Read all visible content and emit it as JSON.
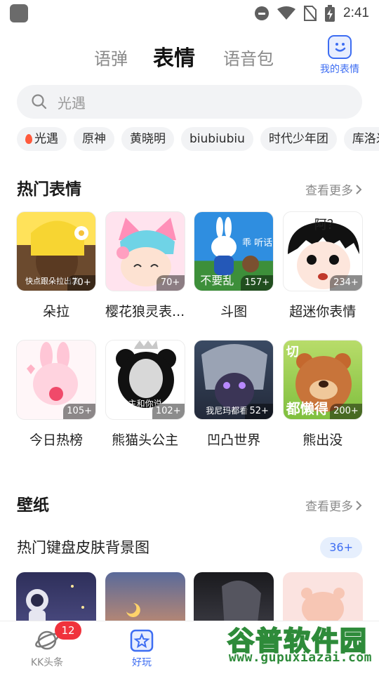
{
  "status_bar": {
    "time": "2:41"
  },
  "tabs": [
    {
      "label": "语弹"
    },
    {
      "label": "表情"
    },
    {
      "label": "语音包"
    }
  ],
  "my_emoji": {
    "label": "我的表情"
  },
  "search": {
    "placeholder": "光遇"
  },
  "chips": [
    {
      "label": "光遇"
    },
    {
      "label": "原神"
    },
    {
      "label": "黄晓明"
    },
    {
      "label": "biubiubiu"
    },
    {
      "label": "时代少年团"
    },
    {
      "label": "库洛米"
    }
  ],
  "hot_emoji": {
    "title": "热门表情",
    "more": "查看更多",
    "items": [
      {
        "label": "朵拉",
        "count": "70+",
        "caption": "快点跟朵拉出发"
      },
      {
        "label": "樱花狼灵表...",
        "count": "70+",
        "caption": ""
      },
      {
        "label": "斗图",
        "count": "157+",
        "caption": "不要乱"
      },
      {
        "label": "超迷你表情",
        "count": "234+",
        "caption": "阿？"
      },
      {
        "label": "今日热榜",
        "count": "105+",
        "caption": ""
      },
      {
        "label": "熊猫头公主",
        "count": "102+",
        "caption": "本公主和你说"
      },
      {
        "label": "凹凸世界",
        "count": "52+",
        "caption": "我尼玛都看"
      },
      {
        "label": "熊出没",
        "count": "200+",
        "caption": "都懒得"
      }
    ]
  },
  "wallpaper": {
    "title": "壁纸",
    "more": "查看更多",
    "subtitle": "热门键盘皮肤背景图",
    "badge": "36+"
  },
  "bottom_nav": [
    {
      "label": "KK头条",
      "badge": "12"
    },
    {
      "label": "好玩"
    }
  ],
  "watermark": {
    "big": "谷普软件园",
    "url": "www.gupuxiazai.com"
  }
}
